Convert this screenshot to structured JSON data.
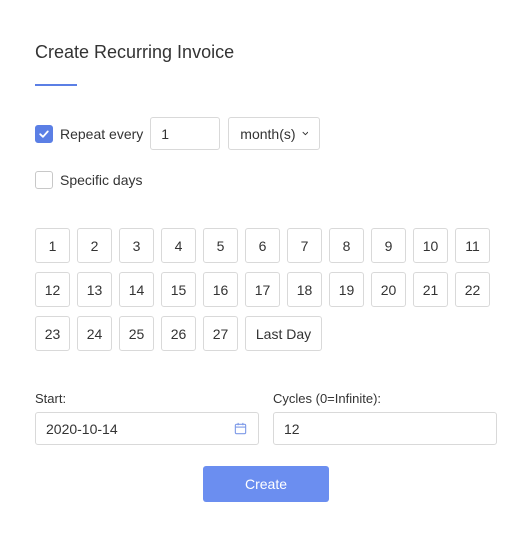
{
  "dialog": {
    "title": "Create Recurring Invoice"
  },
  "repeat": {
    "checked": true,
    "label": "Repeat every",
    "interval_value": "1",
    "unit_label": "month(s)"
  },
  "specific_days": {
    "checked": false,
    "label": "Specific days"
  },
  "days": [
    "1",
    "2",
    "3",
    "4",
    "5",
    "6",
    "7",
    "8",
    "9",
    "10",
    "11",
    "12",
    "13",
    "14",
    "15",
    "16",
    "17",
    "18",
    "19",
    "20",
    "21",
    "22",
    "23",
    "24",
    "25",
    "26",
    "27",
    "Last Day"
  ],
  "start": {
    "label": "Start:",
    "value": "2020-10-14"
  },
  "cycles": {
    "label": "Cycles (0=Infinite):",
    "value": "12"
  },
  "actions": {
    "create_label": "Create"
  },
  "colors": {
    "accent": "#5b7fe5",
    "primary_button": "#6b8ef0"
  }
}
